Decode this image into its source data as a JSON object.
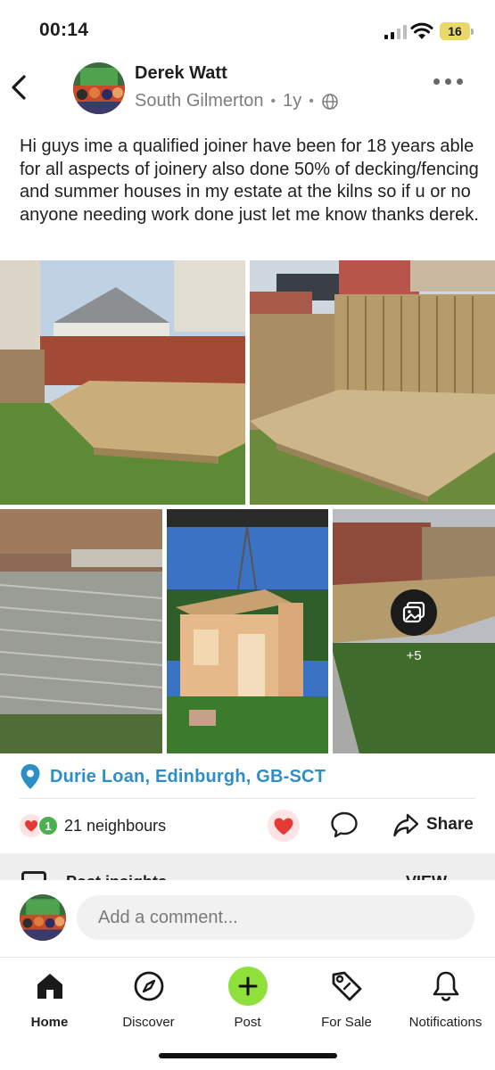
{
  "status_bar": {
    "time": "00:14",
    "battery": "16"
  },
  "post": {
    "author": "Derek Watt",
    "location": "South Gilmerton",
    "age": "1y",
    "body": "Hi guys ime a qualified joiner have been for 18 years able for all aspects of joinery also done 50% of decking/fencing and summer houses in my estate at the kilns so if u or no anyone needing work done just let me know thanks derek.",
    "photos_more": "+5",
    "tagged_location": "Durie Loan, Edinburgh, GB-SCT",
    "reaction_plus": "1",
    "reaction_count": "21 neighbours",
    "share_label": "Share"
  },
  "insights": {
    "label": "Post insights",
    "view": "VIEW"
  },
  "comment": {
    "placeholder": "Add a comment..."
  },
  "tabs": [
    {
      "label": "Home",
      "icon": "home-icon",
      "active": true
    },
    {
      "label": "Discover",
      "icon": "compass-icon"
    },
    {
      "label": "Post",
      "icon": "plus-icon"
    },
    {
      "label": "For Sale",
      "icon": "tag-icon"
    },
    {
      "label": "Notifications",
      "icon": "bell-icon"
    }
  ],
  "colors": {
    "accent": "#2d8fc7",
    "post_button": "#8fe03a",
    "heart": "#e53935",
    "neighbour_badge": "#4caf50"
  }
}
